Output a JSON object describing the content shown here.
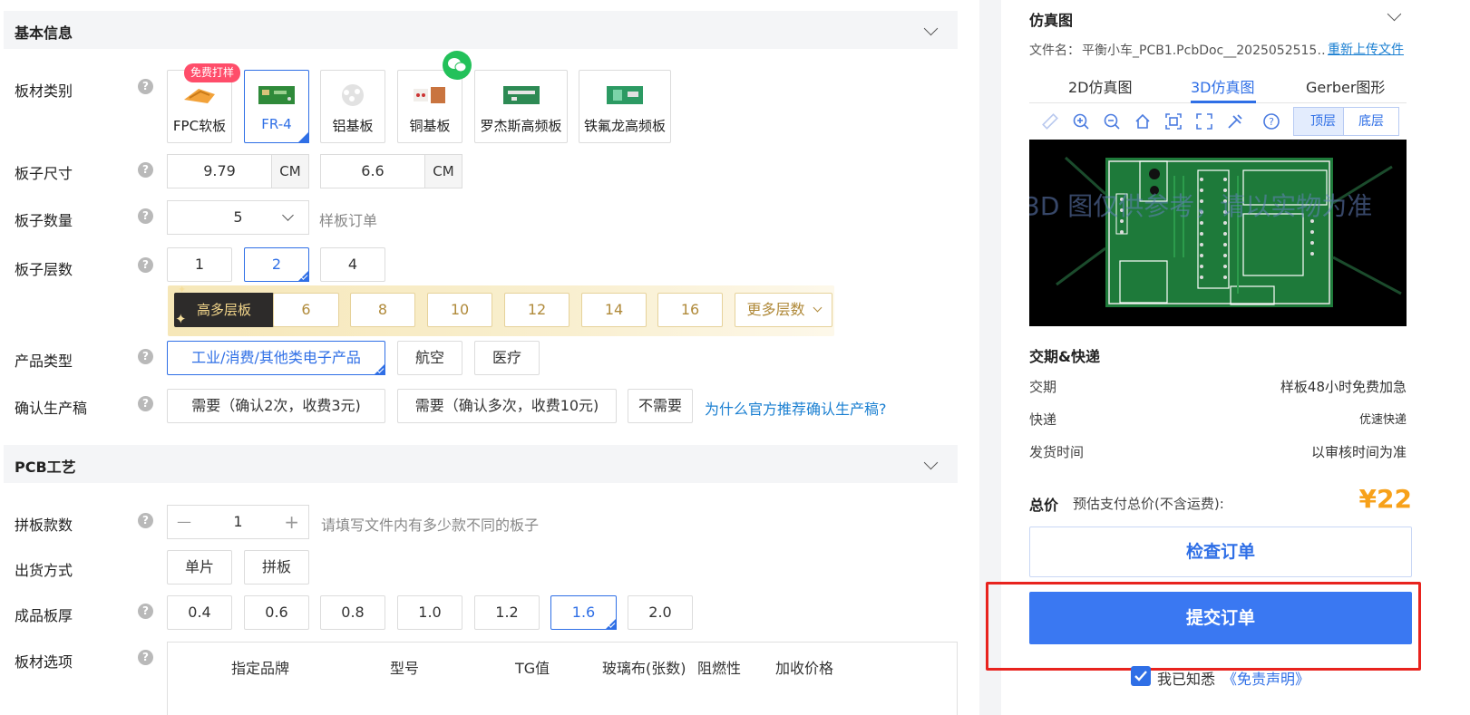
{
  "basic": {
    "section_title": "基本信息",
    "material_label": "板材类别",
    "materials": [
      {
        "label": "FPC软板",
        "badge": "免费打样"
      },
      {
        "label": "FR-4"
      },
      {
        "label": "铝基板"
      },
      {
        "label": "铜基板"
      },
      {
        "label": "罗杰斯高频板"
      },
      {
        "label": "铁氟龙高频板"
      }
    ],
    "size_label": "板子尺寸",
    "size_width": "9.79",
    "size_height": "6.6",
    "size_unit": "CM",
    "qty_label": "板子数量",
    "qty_value": "5",
    "qty_hint": "样板订单",
    "layers_label": "板子层数",
    "layers": [
      "1",
      "2",
      "4"
    ],
    "high_layer_label": "高多层板",
    "high_layers": [
      "6",
      "8",
      "10",
      "12",
      "14",
      "16"
    ],
    "more_layers": "更多层数",
    "product_label": "产品类型",
    "products": [
      "工业/消费/其他类电子产品",
      "航空",
      "医疗"
    ],
    "confirm_label": "确认生产稿",
    "confirm_options": [
      "需要（确认2次，收费3元)",
      "需要（确认多次，收费10元)",
      "不需要"
    ],
    "confirm_link": "为什么官方推荐确认生产稿?"
  },
  "pcb": {
    "section_title": "PCB工艺",
    "panel_label": "拼板款数",
    "panel_value": "1",
    "panel_minus": "—",
    "panel_plus": "+",
    "panel_hint": "请填写文件内有多少款不同的板子",
    "ship_label": "出货方式",
    "ship_options": [
      "单片",
      "拼板"
    ],
    "thickness_label": "成品板厚",
    "thickness_options": [
      "0.4",
      "0.6",
      "0.8",
      "1.0",
      "1.2",
      "1.6",
      "2.0"
    ],
    "material_opt_label": "板材选项",
    "table_headers": [
      "指定品牌",
      "型号",
      "TG值",
      "玻璃布(张数)",
      "阻燃性",
      "加收价格"
    ]
  },
  "sim": {
    "title": "仿真图",
    "file_label": "文件名：",
    "file_name": "平衡小车_PCB1.PcbDoc__2025052515…",
    "reupload": "重新上传文件",
    "tabs": [
      "2D仿真图",
      "3D仿真图",
      "Gerber图形"
    ],
    "layer_top": "顶层",
    "layer_bottom": "底层",
    "watermark": "3D 图仅供参考，请以实物为准",
    "tools": [
      "ruler-icon",
      "zoom-in-icon",
      "zoom-out-icon",
      "home-icon",
      "fit-icon",
      "fullscreen-icon",
      "tools-icon",
      "help-icon"
    ]
  },
  "delivery": {
    "title": "交期&快递",
    "rows": [
      {
        "key": "交期",
        "value": "样板48小时免费加急"
      },
      {
        "key": "快递",
        "value": "优速快递"
      },
      {
        "key": "发货时间",
        "value": "以审核时间为准"
      }
    ]
  },
  "summary": {
    "total_label": "总价",
    "total_hint": "预估支付总价(不含运费):",
    "total_price": "¥22",
    "check_order": "检查订单",
    "submit_order": "提交订单",
    "agree_text": "我已知悉",
    "disclaimer": "《免责声明》"
  },
  "colors": {
    "accent": "#2f6fe6",
    "price": "#f7a11a",
    "highlight_frame": "#e8231e"
  }
}
